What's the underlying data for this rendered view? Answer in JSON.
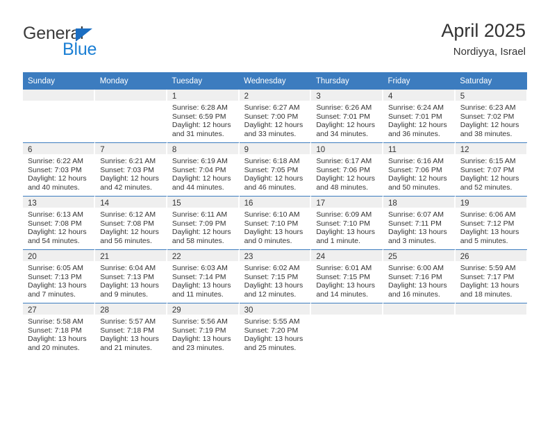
{
  "brand": {
    "name_part1": "General",
    "name_part2": "Blue",
    "triangle_color": "#1b6ec2",
    "blue_color": "#1b7fd4"
  },
  "header": {
    "title": "April 2025",
    "location": "Nordiyya, Israel",
    "header_bg": "#3c7cbf",
    "daynum_bg": "#efefef"
  },
  "weekday_headers": [
    "Sunday",
    "Monday",
    "Tuesday",
    "Wednesday",
    "Thursday",
    "Friday",
    "Saturday"
  ],
  "labels": {
    "sunrise_prefix": "Sunrise:",
    "sunset_prefix": "Sunset:",
    "daylight_prefix": "Daylight:"
  },
  "weeks": [
    [
      {
        "day": "",
        "sunrise": "",
        "sunset": "",
        "daylight_line1": "",
        "daylight_line2": ""
      },
      {
        "day": "",
        "sunrise": "",
        "sunset": "",
        "daylight_line1": "",
        "daylight_line2": ""
      },
      {
        "day": "1",
        "sunrise": "Sunrise: 6:28 AM",
        "sunset": "Sunset: 6:59 PM",
        "daylight_line1": "Daylight: 12 hours",
        "daylight_line2": "and 31 minutes."
      },
      {
        "day": "2",
        "sunrise": "Sunrise: 6:27 AM",
        "sunset": "Sunset: 7:00 PM",
        "daylight_line1": "Daylight: 12 hours",
        "daylight_line2": "and 33 minutes."
      },
      {
        "day": "3",
        "sunrise": "Sunrise: 6:26 AM",
        "sunset": "Sunset: 7:01 PM",
        "daylight_line1": "Daylight: 12 hours",
        "daylight_line2": "and 34 minutes."
      },
      {
        "day": "4",
        "sunrise": "Sunrise: 6:24 AM",
        "sunset": "Sunset: 7:01 PM",
        "daylight_line1": "Daylight: 12 hours",
        "daylight_line2": "and 36 minutes."
      },
      {
        "day": "5",
        "sunrise": "Sunrise: 6:23 AM",
        "sunset": "Sunset: 7:02 PM",
        "daylight_line1": "Daylight: 12 hours",
        "daylight_line2": "and 38 minutes."
      }
    ],
    [
      {
        "day": "6",
        "sunrise": "Sunrise: 6:22 AM",
        "sunset": "Sunset: 7:03 PM",
        "daylight_line1": "Daylight: 12 hours",
        "daylight_line2": "and 40 minutes."
      },
      {
        "day": "7",
        "sunrise": "Sunrise: 6:21 AM",
        "sunset": "Sunset: 7:03 PM",
        "daylight_line1": "Daylight: 12 hours",
        "daylight_line2": "and 42 minutes."
      },
      {
        "day": "8",
        "sunrise": "Sunrise: 6:19 AM",
        "sunset": "Sunset: 7:04 PM",
        "daylight_line1": "Daylight: 12 hours",
        "daylight_line2": "and 44 minutes."
      },
      {
        "day": "9",
        "sunrise": "Sunrise: 6:18 AM",
        "sunset": "Sunset: 7:05 PM",
        "daylight_line1": "Daylight: 12 hours",
        "daylight_line2": "and 46 minutes."
      },
      {
        "day": "10",
        "sunrise": "Sunrise: 6:17 AM",
        "sunset": "Sunset: 7:06 PM",
        "daylight_line1": "Daylight: 12 hours",
        "daylight_line2": "and 48 minutes."
      },
      {
        "day": "11",
        "sunrise": "Sunrise: 6:16 AM",
        "sunset": "Sunset: 7:06 PM",
        "daylight_line1": "Daylight: 12 hours",
        "daylight_line2": "and 50 minutes."
      },
      {
        "day": "12",
        "sunrise": "Sunrise: 6:15 AM",
        "sunset": "Sunset: 7:07 PM",
        "daylight_line1": "Daylight: 12 hours",
        "daylight_line2": "and 52 minutes."
      }
    ],
    [
      {
        "day": "13",
        "sunrise": "Sunrise: 6:13 AM",
        "sunset": "Sunset: 7:08 PM",
        "daylight_line1": "Daylight: 12 hours",
        "daylight_line2": "and 54 minutes."
      },
      {
        "day": "14",
        "sunrise": "Sunrise: 6:12 AM",
        "sunset": "Sunset: 7:08 PM",
        "daylight_line1": "Daylight: 12 hours",
        "daylight_line2": "and 56 minutes."
      },
      {
        "day": "15",
        "sunrise": "Sunrise: 6:11 AM",
        "sunset": "Sunset: 7:09 PM",
        "daylight_line1": "Daylight: 12 hours",
        "daylight_line2": "and 58 minutes."
      },
      {
        "day": "16",
        "sunrise": "Sunrise: 6:10 AM",
        "sunset": "Sunset: 7:10 PM",
        "daylight_line1": "Daylight: 13 hours",
        "daylight_line2": "and 0 minutes."
      },
      {
        "day": "17",
        "sunrise": "Sunrise: 6:09 AM",
        "sunset": "Sunset: 7:10 PM",
        "daylight_line1": "Daylight: 13 hours",
        "daylight_line2": "and 1 minute."
      },
      {
        "day": "18",
        "sunrise": "Sunrise: 6:07 AM",
        "sunset": "Sunset: 7:11 PM",
        "daylight_line1": "Daylight: 13 hours",
        "daylight_line2": "and 3 minutes."
      },
      {
        "day": "19",
        "sunrise": "Sunrise: 6:06 AM",
        "sunset": "Sunset: 7:12 PM",
        "daylight_line1": "Daylight: 13 hours",
        "daylight_line2": "and 5 minutes."
      }
    ],
    [
      {
        "day": "20",
        "sunrise": "Sunrise: 6:05 AM",
        "sunset": "Sunset: 7:13 PM",
        "daylight_line1": "Daylight: 13 hours",
        "daylight_line2": "and 7 minutes."
      },
      {
        "day": "21",
        "sunrise": "Sunrise: 6:04 AM",
        "sunset": "Sunset: 7:13 PM",
        "daylight_line1": "Daylight: 13 hours",
        "daylight_line2": "and 9 minutes."
      },
      {
        "day": "22",
        "sunrise": "Sunrise: 6:03 AM",
        "sunset": "Sunset: 7:14 PM",
        "daylight_line1": "Daylight: 13 hours",
        "daylight_line2": "and 11 minutes."
      },
      {
        "day": "23",
        "sunrise": "Sunrise: 6:02 AM",
        "sunset": "Sunset: 7:15 PM",
        "daylight_line1": "Daylight: 13 hours",
        "daylight_line2": "and 12 minutes."
      },
      {
        "day": "24",
        "sunrise": "Sunrise: 6:01 AM",
        "sunset": "Sunset: 7:15 PM",
        "daylight_line1": "Daylight: 13 hours",
        "daylight_line2": "and 14 minutes."
      },
      {
        "day": "25",
        "sunrise": "Sunrise: 6:00 AM",
        "sunset": "Sunset: 7:16 PM",
        "daylight_line1": "Daylight: 13 hours",
        "daylight_line2": "and 16 minutes."
      },
      {
        "day": "26",
        "sunrise": "Sunrise: 5:59 AM",
        "sunset": "Sunset: 7:17 PM",
        "daylight_line1": "Daylight: 13 hours",
        "daylight_line2": "and 18 minutes."
      }
    ],
    [
      {
        "day": "27",
        "sunrise": "Sunrise: 5:58 AM",
        "sunset": "Sunset: 7:18 PM",
        "daylight_line1": "Daylight: 13 hours",
        "daylight_line2": "and 20 minutes."
      },
      {
        "day": "28",
        "sunrise": "Sunrise: 5:57 AM",
        "sunset": "Sunset: 7:18 PM",
        "daylight_line1": "Daylight: 13 hours",
        "daylight_line2": "and 21 minutes."
      },
      {
        "day": "29",
        "sunrise": "Sunrise: 5:56 AM",
        "sunset": "Sunset: 7:19 PM",
        "daylight_line1": "Daylight: 13 hours",
        "daylight_line2": "and 23 minutes."
      },
      {
        "day": "30",
        "sunrise": "Sunrise: 5:55 AM",
        "sunset": "Sunset: 7:20 PM",
        "daylight_line1": "Daylight: 13 hours",
        "daylight_line2": "and 25 minutes."
      },
      {
        "day": "",
        "sunrise": "",
        "sunset": "",
        "daylight_line1": "",
        "daylight_line2": ""
      },
      {
        "day": "",
        "sunrise": "",
        "sunset": "",
        "daylight_line1": "",
        "daylight_line2": ""
      },
      {
        "day": "",
        "sunrise": "",
        "sunset": "",
        "daylight_line1": "",
        "daylight_line2": ""
      }
    ]
  ]
}
